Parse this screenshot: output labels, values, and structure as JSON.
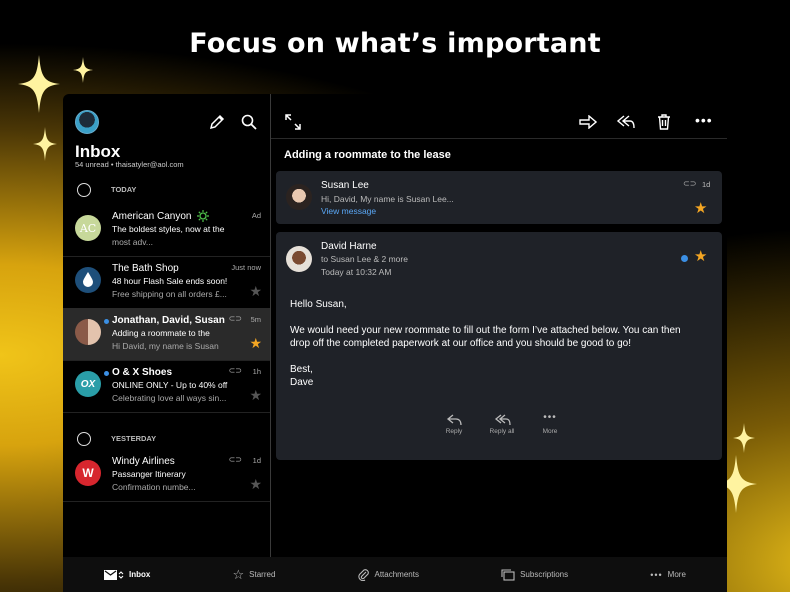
{
  "headline": "Focus on what’s important",
  "left": {
    "title": "Inbox",
    "subtitle": "54 unread  •  thaisatyler@aol.com",
    "sections": {
      "today": "TODAY",
      "yesterday": "YESTERDAY"
    },
    "rows": [
      {
        "name": "American Canyon",
        "line2": "The boldest styles, now at the",
        "line3": "most adv...",
        "time": "Ad",
        "avatar_text": "AC"
      },
      {
        "name": "The Bath Shop",
        "line2": "48 hour Flash Sale ends soon!",
        "line3": "Free shipping on all orders £...",
        "time": "Just now"
      },
      {
        "name": "Jonathan, David, Susan",
        "line2": "Adding a roommate to the",
        "line3": "Hi David, my name is Susan",
        "time": "5m"
      },
      {
        "name": "O & X Shoes",
        "line2": "ONLINE ONLY - Up to 40% off",
        "line3": "Celebrating love all ways sin...",
        "time": "1h",
        "avatar_text": "OX"
      },
      {
        "name": "Windy Airlines",
        "line2": "Passanger Itinerary",
        "line3": "Confirmation numbe...",
        "time": "1d",
        "avatar_text": "W"
      }
    ]
  },
  "right": {
    "subject": "Adding a roommate to the lease",
    "msg1": {
      "name": "Susan Lee",
      "preview": "Hi, David, My name is Susan Lee...",
      "link": "View message",
      "time": "1d"
    },
    "msg2": {
      "name": "David Harne",
      "to": "to Susan Lee & 2 more",
      "time": "Today at 10:32 AM",
      "greeting": "Hello Susan,",
      "body": "We would need your new roommate to fill out the form I’ve attached below. You can then drop off the completed paperwork at our office and you should be good to go!",
      "closing": "Best,",
      "signature": "Dave"
    },
    "actions": {
      "reply": "Reply",
      "reply_all": "Reply all",
      "more": "More"
    }
  },
  "nav": {
    "inbox": "Inbox",
    "starred": "Starred",
    "attachments": "Attachments",
    "subscriptions": "Subscriptions",
    "more": "More"
  },
  "colors": {
    "accent_star": "#f4a623",
    "link": "#5aa7f5",
    "unread_dot": "#3b8fe4",
    "card": "#1f2228"
  }
}
